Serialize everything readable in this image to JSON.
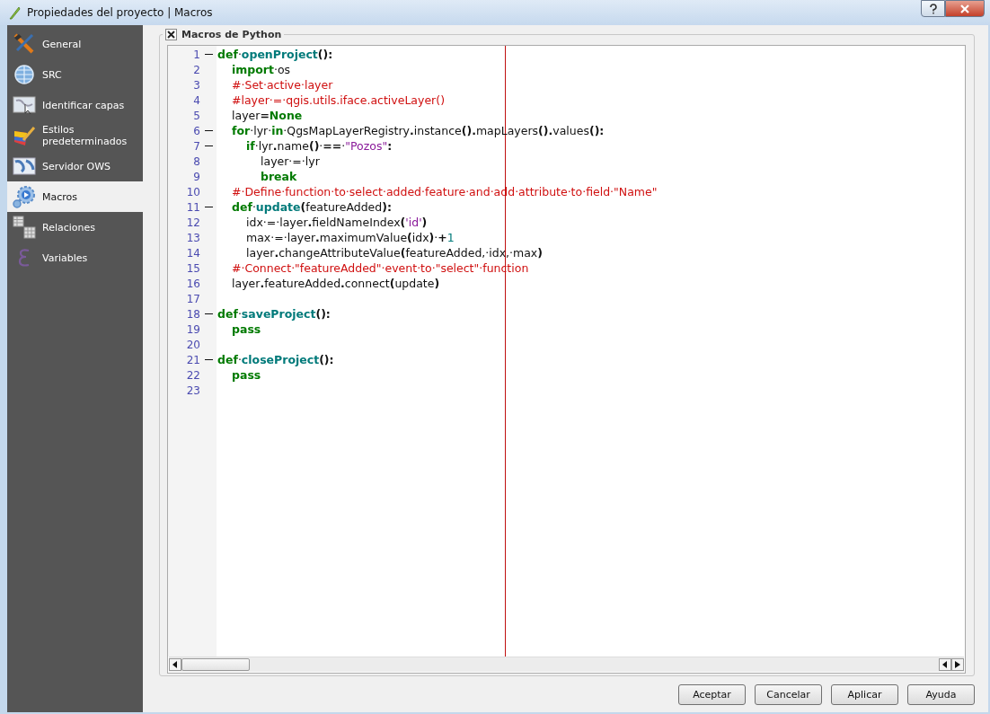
{
  "window": {
    "title": "Propiedades del proyecto | Macros"
  },
  "sidebar": {
    "items": [
      {
        "label": "General",
        "selected": false
      },
      {
        "label": "SRC",
        "selected": false
      },
      {
        "label": "Identificar capas",
        "selected": false
      },
      {
        "label": "Estilos predeterminados",
        "selected": false
      },
      {
        "label": "Servidor OWS",
        "selected": false
      },
      {
        "label": "Macros",
        "selected": true
      },
      {
        "label": "Relaciones",
        "selected": false
      },
      {
        "label": "Variables",
        "selected": false
      }
    ]
  },
  "group": {
    "title": "Macros de Python",
    "checked": true
  },
  "editor": {
    "lines": [
      {
        "n": "1",
        "tokens": [
          {
            "kind": "kw",
            "t": "def"
          },
          {
            "kind": "tx",
            "t": "·"
          },
          {
            "kind": "fn",
            "t": "openProject"
          },
          {
            "kind": "op",
            "t": "():"
          }
        ],
        "children": [
          {
            "n": "2",
            "tokens": [
              {
                "kind": "kw",
                "t": "import"
              },
              {
                "kind": "tx",
                "t": "·os"
              }
            ]
          },
          {
            "n": "3",
            "tokens": [
              {
                "kind": "cm",
                "t": "#·Set·active·layer"
              }
            ]
          },
          {
            "n": "4",
            "tokens": [
              {
                "kind": "cm",
                "t": "#layer·=·qgis.utils.iface.activeLayer()"
              }
            ]
          },
          {
            "n": "5",
            "tokens": [
              {
                "kind": "tx",
                "t": "layer"
              },
              {
                "kind": "op",
                "t": "="
              },
              {
                "kind": "kw",
                "t": "None"
              }
            ]
          },
          {
            "n": "6",
            "tokens": [
              {
                "kind": "kw",
                "t": "for"
              },
              {
                "kind": "tx",
                "t": "·lyr·"
              },
              {
                "kind": "kw",
                "t": "in"
              },
              {
                "kind": "tx",
                "t": "·QgsMapLayerRegistry"
              },
              {
                "kind": "op",
                "t": "."
              },
              {
                "kind": "tx",
                "t": "instance"
              },
              {
                "kind": "op",
                "t": "()."
              },
              {
                "kind": "tx",
                "t": "mapLayers"
              },
              {
                "kind": "op",
                "t": "()."
              },
              {
                "kind": "tx",
                "t": "values"
              },
              {
                "kind": "op",
                "t": "():"
              }
            ],
            "children": [
              {
                "n": "7",
                "tokens": [
                  {
                    "kind": "kw",
                    "t": "if"
                  },
                  {
                    "kind": "tx",
                    "t": "·lyr"
                  },
                  {
                    "kind": "op",
                    "t": "."
                  },
                  {
                    "kind": "tx",
                    "t": "name"
                  },
                  {
                    "kind": "op",
                    "t": "()"
                  },
                  {
                    "kind": "tx",
                    "t": "·"
                  },
                  {
                    "kind": "op",
                    "t": "=="
                  },
                  {
                    "kind": "tx",
                    "t": "·"
                  },
                  {
                    "kind": "str",
                    "t": "\"Pozos\""
                  },
                  {
                    "kind": "op",
                    "t": ":"
                  }
                ],
                "children": [
                  {
                    "n": "8",
                    "tokens": [
                      {
                        "kind": "tx",
                        "t": "layer·=·lyr"
                      }
                    ]
                  },
                  {
                    "n": "9",
                    "tokens": [
                      {
                        "kind": "kw",
                        "t": "break"
                      }
                    ]
                  }
                ]
              }
            ]
          },
          {
            "n": "10",
            "tokens": [
              {
                "kind": "cm",
                "t": "#·Define·function·to·select·added·feature·and·add·attribute·to·field·\"Name\""
              }
            ]
          },
          {
            "n": "11",
            "tokens": [
              {
                "kind": "kw",
                "t": "def"
              },
              {
                "kind": "tx",
                "t": "·"
              },
              {
                "kind": "fn",
                "t": "update"
              },
              {
                "kind": "op",
                "t": "("
              },
              {
                "kind": "tx",
                "t": "featureAdded"
              },
              {
                "kind": "op",
                "t": "):"
              }
            ],
            "children": [
              {
                "n": "12",
                "tokens": [
                  {
                    "kind": "tx",
                    "t": "idx·=·layer"
                  },
                  {
                    "kind": "op",
                    "t": "."
                  },
                  {
                    "kind": "tx",
                    "t": "fieldNameIndex"
                  },
                  {
                    "kind": "op",
                    "t": "("
                  },
                  {
                    "kind": "str",
                    "t": "'id'"
                  },
                  {
                    "kind": "op",
                    "t": ")"
                  }
                ]
              },
              {
                "n": "13",
                "tokens": [
                  {
                    "kind": "tx",
                    "t": "max·=·layer"
                  },
                  {
                    "kind": "op",
                    "t": "."
                  },
                  {
                    "kind": "tx",
                    "t": "maximumValue"
                  },
                  {
                    "kind": "op",
                    "t": "("
                  },
                  {
                    "kind": "tx",
                    "t": "idx"
                  },
                  {
                    "kind": "op",
                    "t": ")"
                  },
                  {
                    "kind": "tx",
                    "t": "·"
                  },
                  {
                    "kind": "op",
                    "t": "+"
                  },
                  {
                    "kind": "num",
                    "t": "1"
                  }
                ]
              },
              {
                "n": "14",
                "tokens": [
                  {
                    "kind": "tx",
                    "t": "layer"
                  },
                  {
                    "kind": "op",
                    "t": "."
                  },
                  {
                    "kind": "tx",
                    "t": "changeAttributeValue"
                  },
                  {
                    "kind": "op",
                    "t": "("
                  },
                  {
                    "kind": "tx",
                    "t": "featureAdded,·idx,·max"
                  },
                  {
                    "kind": "op",
                    "t": ")"
                  }
                ]
              }
            ]
          },
          {
            "n": "15",
            "tokens": [
              {
                "kind": "cm",
                "t": "#·Connect·\"featureAdded\"·event·to·\"select\"·function"
              }
            ]
          },
          {
            "n": "16",
            "tokens": [
              {
                "kind": "tx",
                "t": "layer"
              },
              {
                "kind": "op",
                "t": "."
              },
              {
                "kind": "tx",
                "t": "featureAdded"
              },
              {
                "kind": "op",
                "t": "."
              },
              {
                "kind": "tx",
                "t": "connect"
              },
              {
                "kind": "op",
                "t": "("
              },
              {
                "kind": "tx",
                "t": "update"
              },
              {
                "kind": "op",
                "t": ")"
              }
            ]
          }
        ]
      },
      {
        "n": "17"
      },
      {
        "n": "18",
        "tokens": [
          {
            "kind": "kw",
            "t": "def"
          },
          {
            "kind": "tx",
            "t": "·"
          },
          {
            "kind": "fn",
            "t": "saveProject"
          },
          {
            "kind": "op",
            "t": "():"
          }
        ],
        "children": [
          {
            "n": "19",
            "tokens": [
              {
                "kind": "kw",
                "t": "pass"
              }
            ]
          }
        ]
      },
      {
        "n": "20"
      },
      {
        "n": "21",
        "tokens": [
          {
            "kind": "kw",
            "t": "def"
          },
          {
            "kind": "tx",
            "t": "·"
          },
          {
            "kind": "fn",
            "t": "closeProject"
          },
          {
            "kind": "op",
            "t": "():"
          }
        ],
        "children": [
          {
            "n": "22",
            "tokens": [
              {
                "kind": "kw",
                "t": "pass"
              }
            ]
          }
        ]
      },
      {
        "n": "23"
      }
    ]
  },
  "buttons": [
    "Aceptar",
    "Cancelar",
    "Aplicar",
    "Ayuda"
  ]
}
